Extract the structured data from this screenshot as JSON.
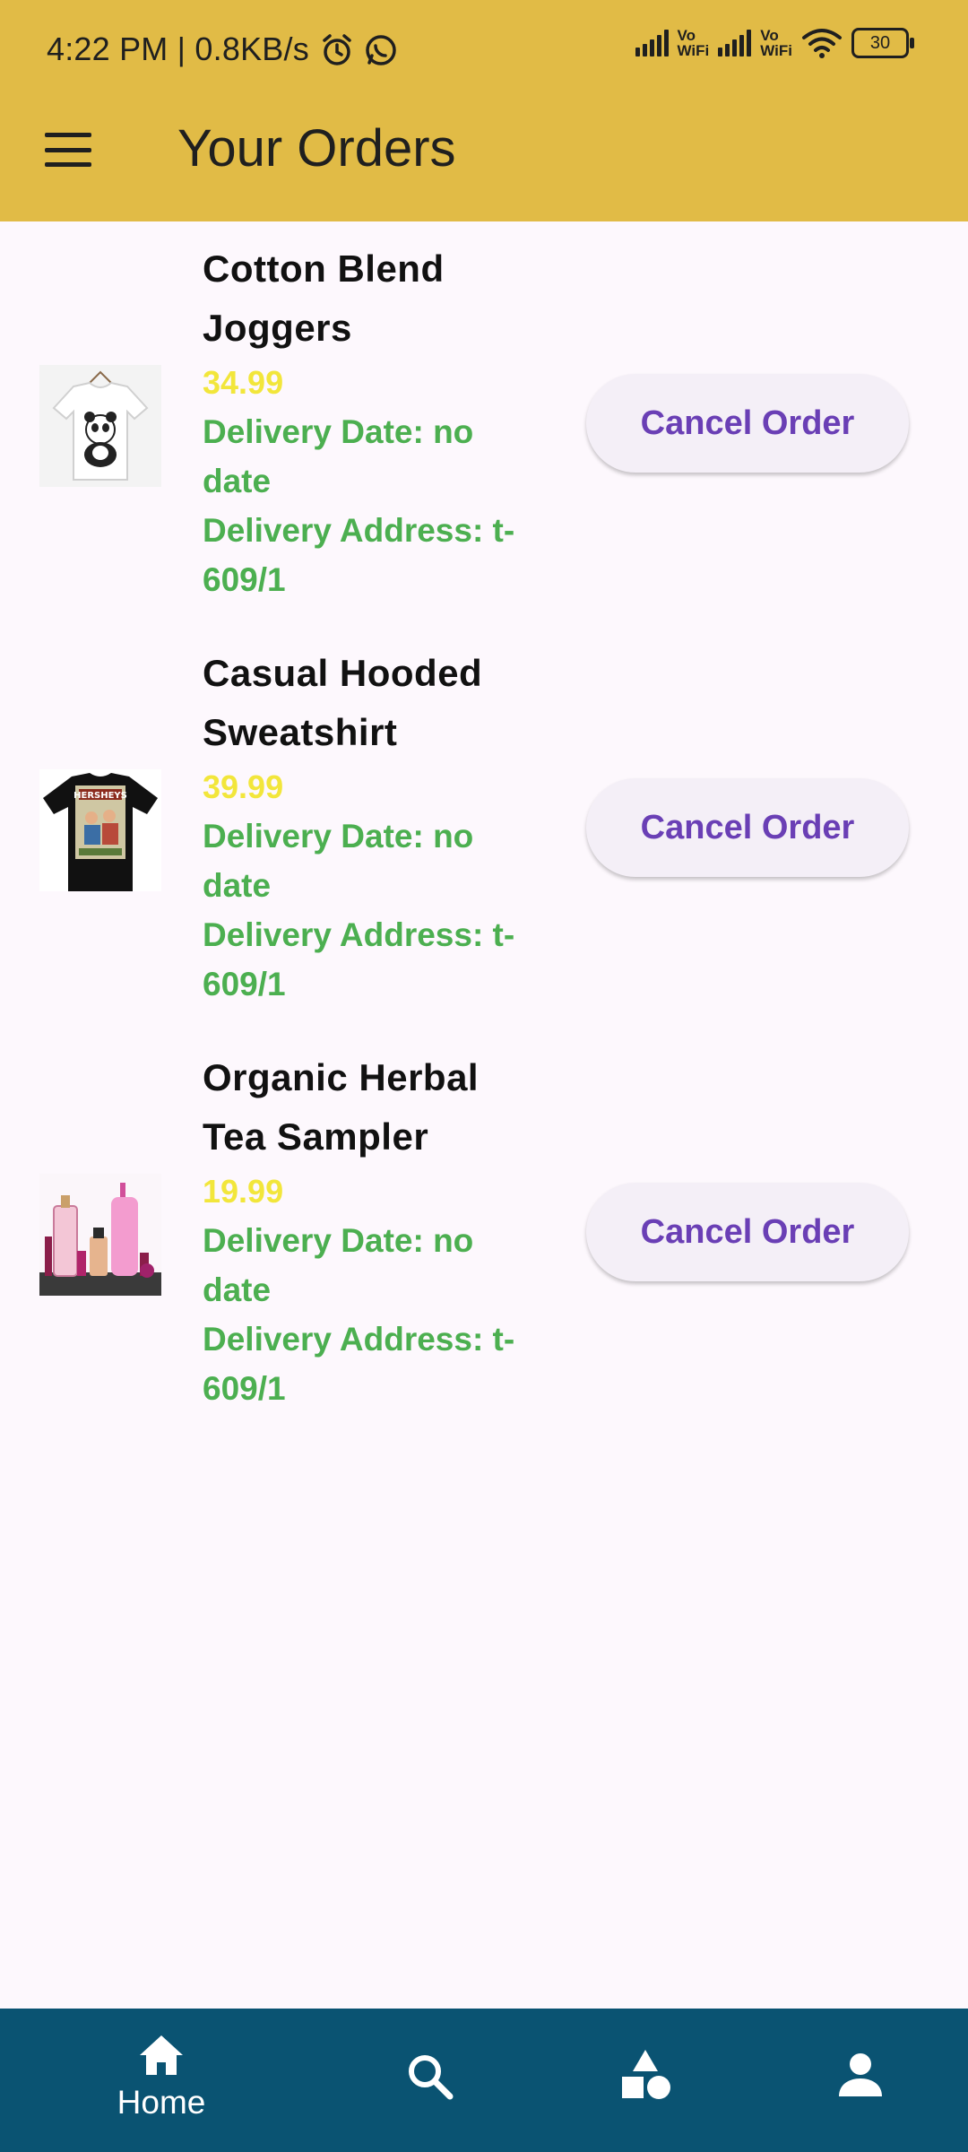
{
  "status_bar": {
    "time_speed": "4:22 PM | 0.8KB/s",
    "battery": "30",
    "vowifi_1": "Vo\nWiFi",
    "vowifi_2": "Vo\nWiFi"
  },
  "app_bar": {
    "title": "Your Orders"
  },
  "orders": [
    {
      "name": "Cotton Blend Joggers",
      "price": "34.99",
      "delivery_date": "Delivery Date: no date",
      "delivery_address": "Delivery Address: t-609/1",
      "button": "Cancel Order"
    },
    {
      "name": "Casual Hooded Sweatshirt",
      "price": "39.99",
      "delivery_date": "Delivery Date: no date",
      "delivery_address": "Delivery Address: t-609/1",
      "button": "Cancel Order"
    },
    {
      "name": "Organic Herbal Tea Sampler",
      "price": "19.99",
      "delivery_date": "Delivery Date: no date",
      "delivery_address": "Delivery Address: t-609/1",
      "button": "Cancel Order"
    }
  ],
  "bottom_nav": {
    "home_label": "Home"
  },
  "colors": {
    "app_bar": "#e1bb46",
    "price": "#f2e63b",
    "meta": "#4caf50",
    "button_text": "#6a3fb5",
    "bottom_nav": "#0a5372"
  },
  "icons": [
    "alarm-icon",
    "whatsapp-icon",
    "signal-icon",
    "wifi-icon",
    "battery-icon",
    "menu-icon",
    "home-icon",
    "search-icon",
    "categories-icon",
    "profile-icon"
  ]
}
